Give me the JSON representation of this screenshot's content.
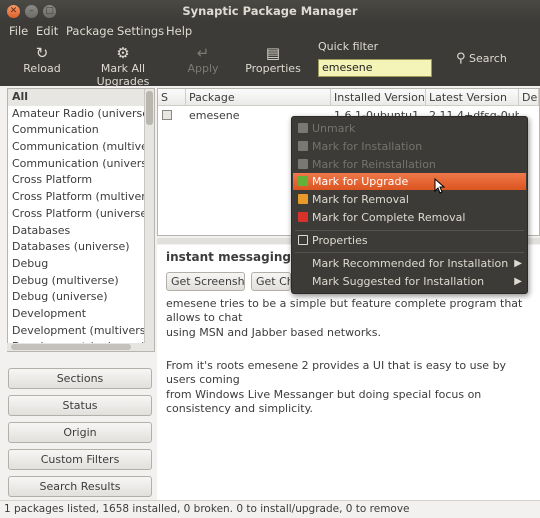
{
  "window": {
    "title": "Synaptic Package Manager"
  },
  "menubar": [
    "File",
    "Edit",
    "Package",
    "Settings",
    "Help"
  ],
  "toolbar": {
    "reload": "Reload",
    "mark_all": "Mark All Upgrades",
    "apply": "Apply",
    "properties": "Properties",
    "quick_filter_label": "Quick filter",
    "quick_filter_value": "emesene",
    "search": "Search"
  },
  "sections": [
    "All",
    "Amateur Radio (universe)",
    "Communication",
    "Communication (multiverse)",
    "Communication (universe)",
    "Cross Platform",
    "Cross Platform (multiverse)",
    "Cross Platform (universe)",
    "Databases",
    "Databases (universe)",
    "Debug",
    "Debug (multiverse)",
    "Debug (universe)",
    "Development",
    "Development (multiverse)",
    "Development (universe)"
  ],
  "side_buttons": [
    "Sections",
    "Status",
    "Origin",
    "Custom Filters",
    "Search Results"
  ],
  "package_table": {
    "headers": [
      "S",
      "Package",
      "Installed Version",
      "Latest Version",
      "De"
    ],
    "rows": [
      {
        "package": "emesene",
        "installed": "1.6.1-0ubuntu1",
        "latest": "2.11.4+dfsg-0ubunt"
      }
    ]
  },
  "description": {
    "title": "instant messaging client",
    "buttons": [
      "Get Screenshot",
      "Get Changelog"
    ],
    "paragraphs": [
      "emesene tries to be a simple but feature complete program that allows to chat",
      "using MSN and Jabber based networks.",
      "From it's roots emesene 2 provides a UI that is easy to use by users coming",
      "from Windows Live Messanger but doing special focus on consistency and simplicity."
    ]
  },
  "status_text": "1 packages listed, 1658 installed, 0 broken. 0 to install/upgrade, 0 to remove",
  "context_menu": {
    "items": [
      {
        "label": "Unmark",
        "state": "disabled",
        "marker_color": "#7a7873"
      },
      {
        "label": "Mark for Installation",
        "state": "disabled",
        "marker_color": "#7a7873"
      },
      {
        "label": "Mark for Reinstallation",
        "state": "disabled",
        "marker_color": "#7a7873"
      },
      {
        "label": "Mark for Upgrade",
        "state": "highlighted",
        "marker_color": "#63b13a"
      },
      {
        "label": "Mark for Removal",
        "state": "enabled",
        "marker_color": "#e89a2b"
      },
      {
        "label": "Mark for Complete Removal",
        "state": "enabled",
        "marker_color": "#d8322b"
      },
      {
        "label": "Properties",
        "state": "enabled",
        "marker_color": ""
      },
      {
        "label": "Mark Recommended for Installation",
        "state": "submenu",
        "marker_color": ""
      },
      {
        "label": "Mark Suggested for Installation",
        "state": "submenu",
        "marker_color": ""
      }
    ]
  },
  "colors": {
    "accent": "#e35d27",
    "toolbar_bg": "#3c3b37",
    "filter_bg": "#f4f4b8"
  }
}
